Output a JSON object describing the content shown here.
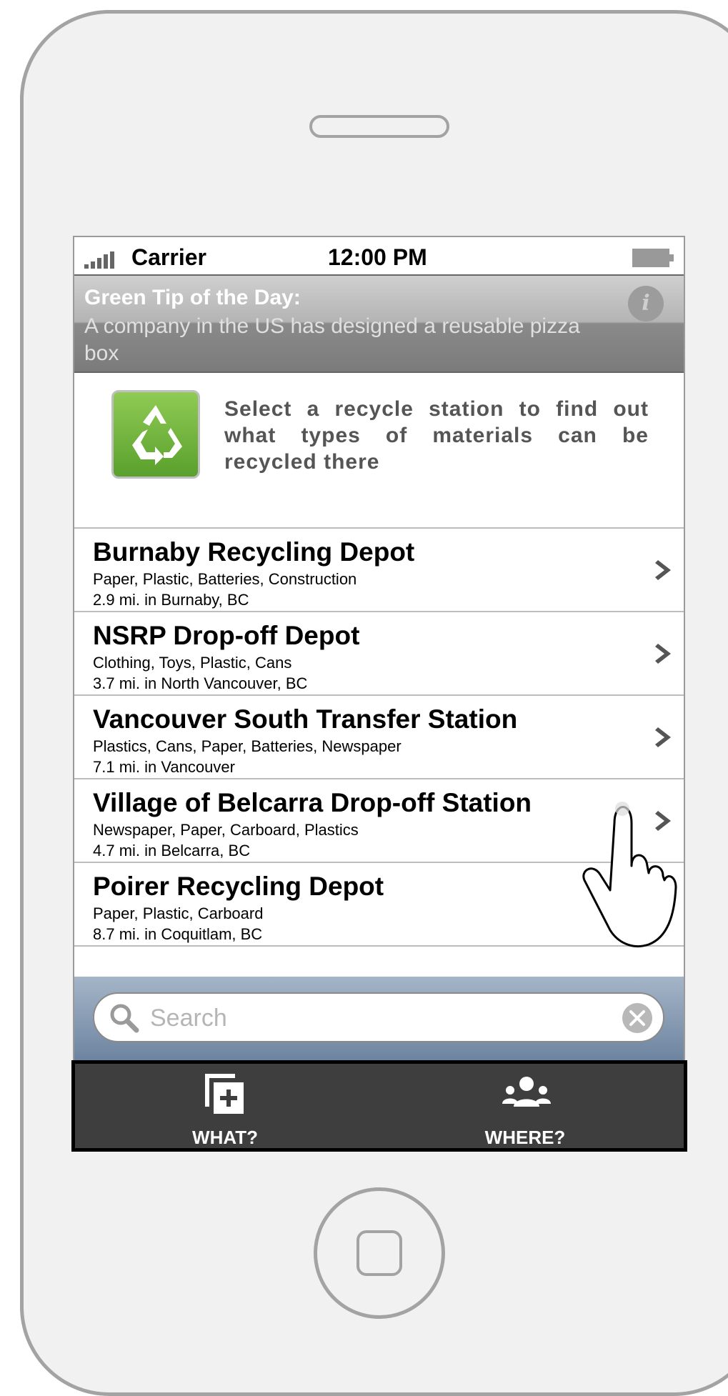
{
  "status_bar": {
    "carrier": "Carrier",
    "time": "12:00 PM",
    "signal_icon": "signal-bars-icon",
    "battery_icon": "battery-icon"
  },
  "tip": {
    "title": "Green Tip of the Day:",
    "text": "A company in the US has designed a reusable pizza box",
    "info_icon": "info-icon",
    "info_glyph": "i"
  },
  "intro": {
    "icon": "recycle-icon",
    "text": "Select a recycle station to find out what types of materials can be recycled there"
  },
  "stations": [
    {
      "name": "Burnaby Recycling Depot",
      "materials": "Paper, Plastic, Batteries, Construction",
      "distance": "2.9 mi. in Burnaby, BC"
    },
    {
      "name": "NSRP Drop-off Depot",
      "materials": "Clothing, Toys, Plastic, Cans",
      "distance": "3.7 mi. in North Vancouver, BC"
    },
    {
      "name": "Vancouver South Transfer Station",
      "materials": "Plastics, Cans, Paper, Batteries, Newspaper",
      "distance": "7.1 mi. in Vancouver"
    },
    {
      "name": "Village of Belcarra Drop-off Station",
      "materials": "Newspaper, Paper, Carboard, Plastics",
      "distance": "4.7 mi. in Belcarra, BC"
    },
    {
      "name": "Poirer Recycling Depot",
      "materials": "Paper, Plastic, Carboard",
      "distance": "8.7 mi. in Coquitlam, BC"
    }
  ],
  "search": {
    "placeholder": "Search",
    "value": "",
    "icon": "search-icon",
    "clear_icon": "clear-icon"
  },
  "tabs": [
    {
      "label": "WHAT?",
      "icon": "add-document-icon"
    },
    {
      "label": "WHERE?",
      "icon": "people-group-icon"
    }
  ],
  "colors": {
    "tab_bar_bg": "#3e3e3e",
    "search_bar_top": "#a5b5c8",
    "search_bar_bottom": "#6d84a0",
    "recycle_green": "#6fb23a",
    "device_frame": "#a3a3a3"
  }
}
